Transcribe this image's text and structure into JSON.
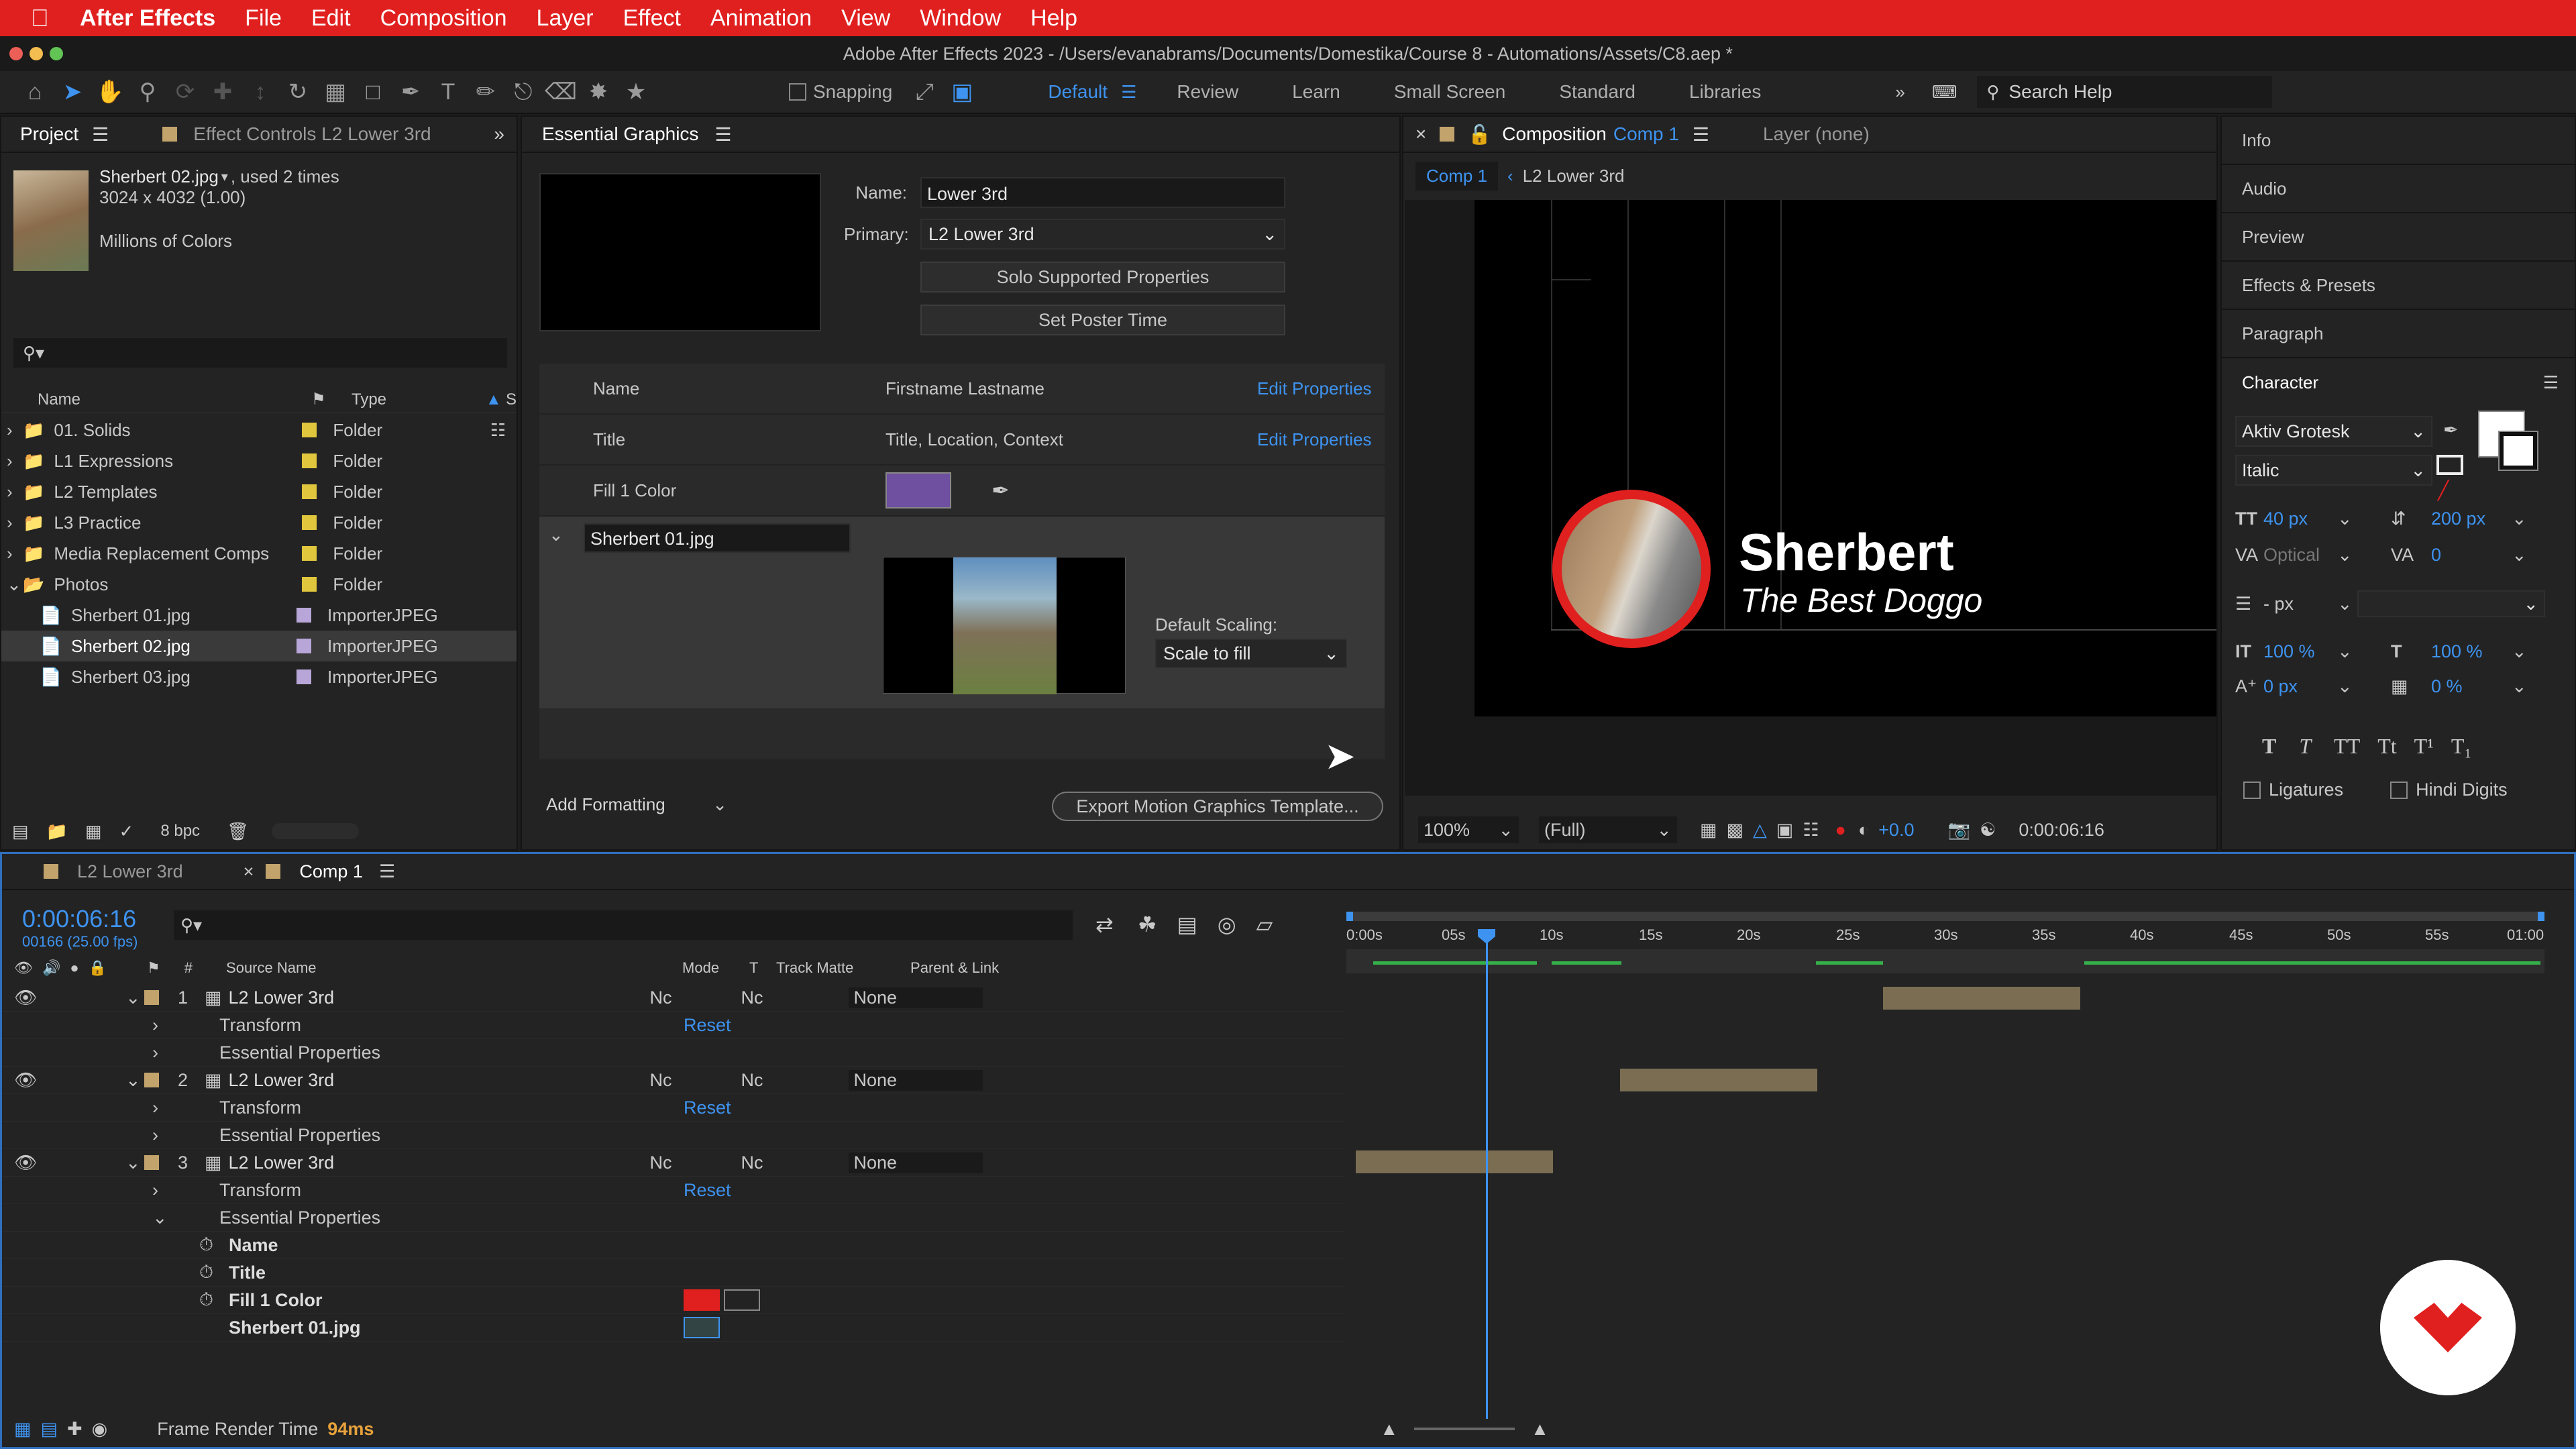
{
  "menubar": {
    "apple": "",
    "app": "After Effects",
    "items": [
      "File",
      "Edit",
      "Composition",
      "Layer",
      "Effect",
      "Animation",
      "View",
      "Window",
      "Help"
    ]
  },
  "titlebar": {
    "title": "Adobe After Effects 2023 - /Users/evanabrams/Documents/Domestika/Course 8 - Automations/Assets/C8.aep *"
  },
  "toolbar": {
    "snapping": "Snapping",
    "workspaces": [
      "Default",
      "Review",
      "Learn",
      "Small Screen",
      "Standard",
      "Libraries"
    ],
    "search": "Search Help"
  },
  "project": {
    "tab": "Project",
    "tab2": "Effect Controls L2 Lower 3rd",
    "item_name": "Sherbert 02.jpg",
    "item_used": ", used 2 times",
    "item_dims": "3024 x 4032 (1.00)",
    "item_colors": "Millions of Colors",
    "col_name": "Name",
    "col_type": "Type",
    "col_s": "S",
    "rows": [
      {
        "name": "01. Solids",
        "type": "Folder",
        "kind": "folder"
      },
      {
        "name": "L1 Expressions",
        "type": "Folder",
        "kind": "folder"
      },
      {
        "name": "L2 Templates",
        "type": "Folder",
        "kind": "folder"
      },
      {
        "name": "L3 Practice",
        "type": "Folder",
        "kind": "folder"
      },
      {
        "name": "Media Replacement Comps",
        "type": "Folder",
        "kind": "folder"
      },
      {
        "name": "Photos",
        "type": "Folder",
        "kind": "folder"
      },
      {
        "name": "Sherbert 01.jpg",
        "type": "ImporterJPEG",
        "kind": "file"
      },
      {
        "name": "Sherbert 02.jpg",
        "type": "ImporterJPEG",
        "kind": "file"
      },
      {
        "name": "Sherbert 03.jpg",
        "type": "ImporterJPEG",
        "kind": "file"
      }
    ],
    "bpc": "8 bpc"
  },
  "eg": {
    "tab": "Essential Graphics",
    "name_label": "Name:",
    "name_value": "Lower 3rd",
    "primary_label": "Primary:",
    "primary_value": "L2 Lower 3rd",
    "solo": "Solo Supported Properties",
    "poster": "Set Poster Time",
    "props": [
      {
        "label": "Name",
        "value": "Firstname Lastname",
        "link": "Edit Properties"
      },
      {
        "label": "Title",
        "value": "Title, Location, Context",
        "link": "Edit Properties"
      },
      {
        "label": "Fill 1 Color",
        "value": "",
        "link": ""
      }
    ],
    "fill_color": "#6e4fa0",
    "media_name": "Sherbert 01.jpg",
    "scaling_label": "Default Scaling:",
    "scaling_value": "Scale to fill",
    "add_formatting": "Add Formatting",
    "export": "Export Motion Graphics Template..."
  },
  "comp": {
    "tab_label": "Composition",
    "tab_name": "Comp 1",
    "layer_tab": "Layer (none)",
    "crumb1": "Comp 1",
    "crumb2": "L2 Lower 3rd",
    "name_text": "Sherbert",
    "title_text": "The Best Doggo",
    "zoom": "100%",
    "quality": "(Full)",
    "exposure": "+0.0",
    "timecode": "0:00:06:16"
  },
  "right": {
    "panels": [
      "Info",
      "Audio",
      "Preview",
      "Effects & Presets",
      "Paragraph"
    ],
    "character": "Character",
    "font": "Aktiv Grotesk",
    "style": "Italic",
    "size": "40 px",
    "leading": "200 px",
    "kerning": "Optical",
    "tracking": "0",
    "stroke": "- px",
    "vscale": "100 %",
    "hscale": "100 %",
    "baseline": "0 px",
    "tsume": "0 %",
    "ligatures": "Ligatures",
    "hindi": "Hindi Digits"
  },
  "timeline": {
    "tab1": "L2 Lower 3rd",
    "tab2": "Comp 1",
    "timecode": "0:00:06:16",
    "frames": "00166 (25.00 fps)",
    "col_source": "Source Name",
    "col_mode": "Mode",
    "col_t": "T",
    "col_matte": "Track Matte",
    "col_parent": "Parent & Link",
    "ruler": [
      "0:00s",
      "05s",
      "10s",
      "15s",
      "20s",
      "25s",
      "30s",
      "35s",
      "40s",
      "45s",
      "50s",
      "55s",
      "01:00"
    ],
    "layers": [
      {
        "num": "1",
        "name": "L2 Lower 3rd",
        "mode": "Nc",
        "matte": "Nc",
        "parent": "None",
        "reset": "Reset",
        "transform": "Transform",
        "ep": "Essential Properties"
      },
      {
        "num": "2",
        "name": "L2 Lower 3rd",
        "mode": "Nc",
        "matte": "Nc",
        "parent": "None",
        "reset": "Reset",
        "transform": "Transform",
        "ep": "Essential Properties"
      },
      {
        "num": "3",
        "name": "L2 Lower 3rd",
        "mode": "Nc",
        "matte": "Nc",
        "parent": "None",
        "reset": "Reset",
        "transform": "Transform",
        "ep": "Essential Properties"
      }
    ],
    "sub": [
      "Name",
      "Title",
      "Fill 1 Color",
      "Sherbert 01.jpg"
    ],
    "fill_swatch": "#e0201f",
    "footer_label": "Frame Render Time",
    "footer_value": "94ms"
  }
}
